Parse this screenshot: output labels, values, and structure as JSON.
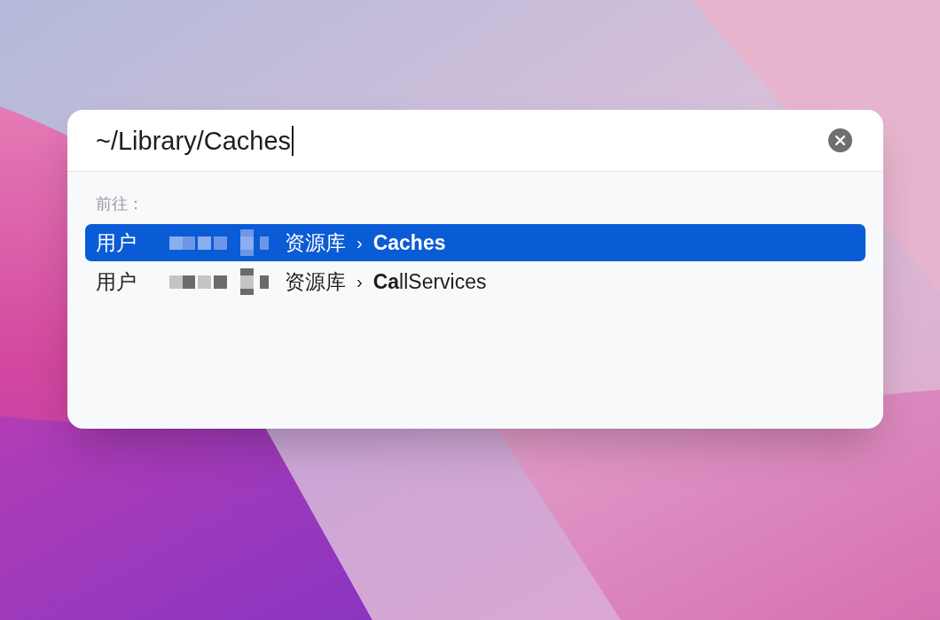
{
  "go_to_folder_dialog": {
    "path_field": {
      "value": "~/Library/Caches",
      "focused": true
    },
    "section_label": "前往：",
    "suggestions": [
      {
        "selected": true,
        "segments": [
          {
            "kind": "folder",
            "text": "用户"
          },
          {
            "kind": "redacted"
          },
          {
            "kind": "folder",
            "text": "资源库"
          },
          {
            "kind": "separator",
            "text": "›"
          },
          {
            "kind": "match",
            "matched": "Caches"
          }
        ]
      },
      {
        "selected": false,
        "segments": [
          {
            "kind": "folder",
            "text": "用户"
          },
          {
            "kind": "redacted"
          },
          {
            "kind": "folder",
            "text": "资源库"
          },
          {
            "kind": "separator",
            "text": "›"
          },
          {
            "kind": "match",
            "matched": "Ca",
            "rest": "llServices"
          }
        ]
      }
    ]
  }
}
